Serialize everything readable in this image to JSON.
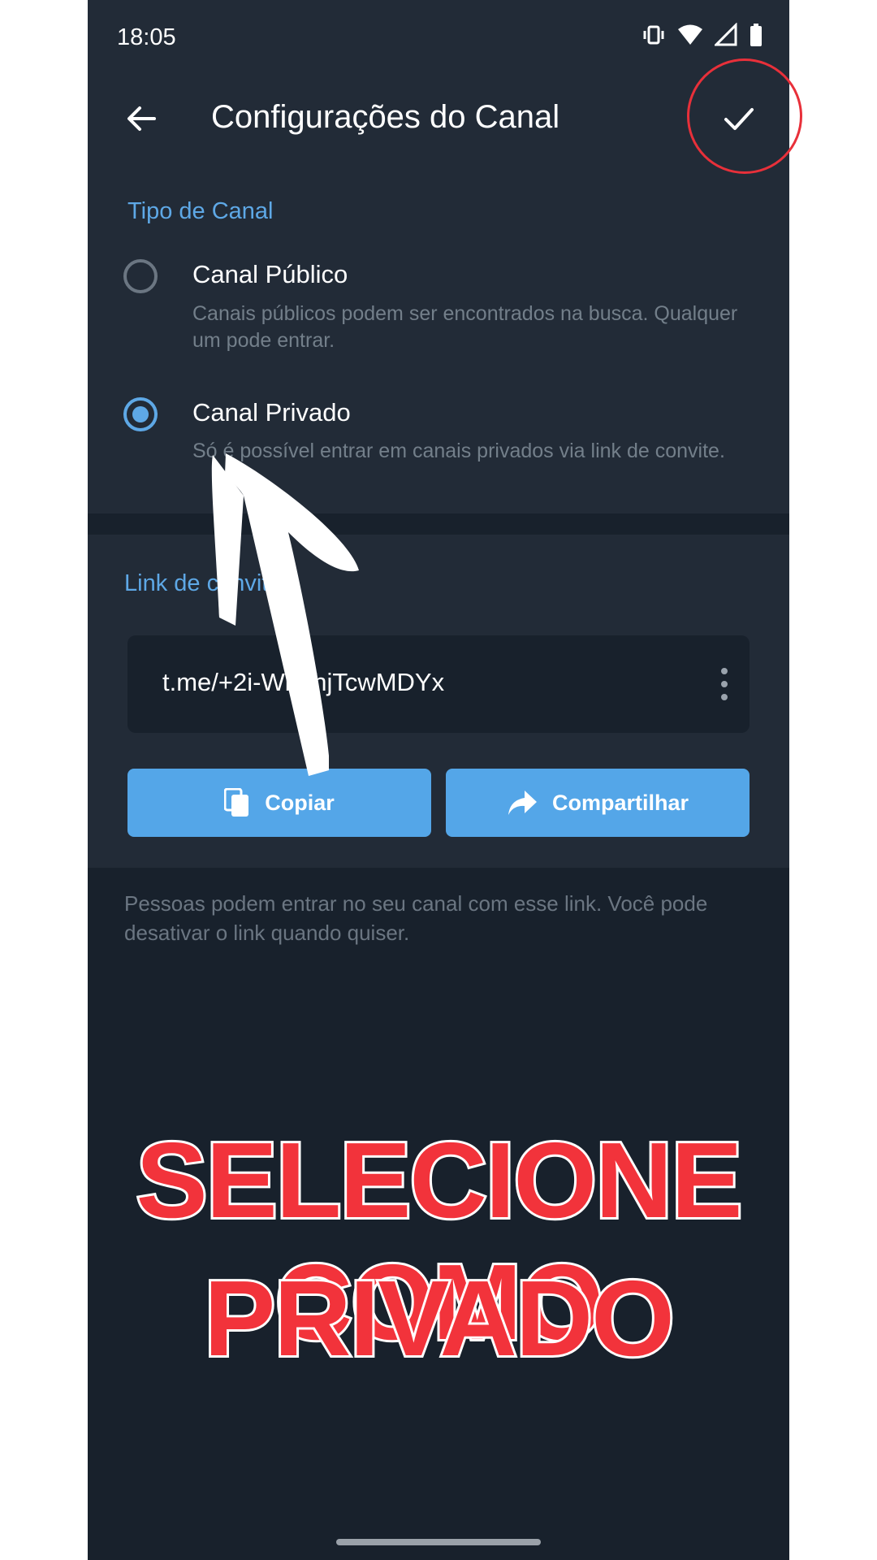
{
  "status_bar": {
    "time": "18:05",
    "icons": [
      "vibrate-icon",
      "wifi-icon",
      "signal-icon",
      "battery-icon"
    ]
  },
  "app_bar": {
    "title": "Configurações do Canal",
    "back_icon": "back-arrow-icon",
    "confirm_icon": "check-icon"
  },
  "channel_type": {
    "section_title": "Tipo de Canal",
    "options": [
      {
        "label": "Canal Público",
        "description": "Canais públicos podem ser encontrados na busca. Qualquer um pode entrar.",
        "selected": false
      },
      {
        "label": "Canal Privado",
        "description": "Só é possível entrar em canais privados via link de convite.",
        "selected": true
      }
    ]
  },
  "invite_link": {
    "section_title": "Link de convite",
    "link": "t.me/+2i-WbqhjTcwMDYx",
    "copy_label": "Copiar",
    "share_label": "Compartilhar",
    "footer": "Pessoas podem entrar no seu canal com esse link. Você pode desativar o link quando quiser."
  },
  "overlay": {
    "caption_line1": "SELECIONE COMO",
    "caption_line2": "PRIVADO",
    "accent_color": "#f2333b"
  },
  "colors": {
    "background": "#18212c",
    "surface": "#222b37",
    "accent": "#5ea8e6",
    "button": "#54a6e8"
  }
}
